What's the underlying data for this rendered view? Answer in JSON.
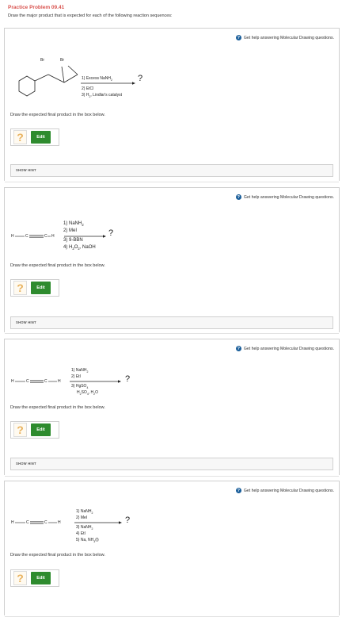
{
  "header": {
    "title": "Practice Problem 09.41",
    "subtitle": "Draw the major product that is expected for each of the following reaction sequences:"
  },
  "help_text": "Get help answering Molecular Drawing questions.",
  "prompt_text": "Draw the expected final product in the box below.",
  "edit_label": "Edit",
  "hint_label": "SHOW HINT",
  "question_mark": "?",
  "placeholder_mark": "?",
  "problems": [
    {
      "atoms": {
        "br1": "Br",
        "br2": "Br"
      },
      "reagents": [
        "1) Excess NaNH",
        "2) EtCl",
        "3) H",
        ", Lindlar's catalyst"
      ],
      "sub_2": "2"
    },
    {
      "atoms": {
        "h_left": "H",
        "c1": "C",
        "c2": "C",
        "h_right": "H"
      },
      "reagents": [
        "1) NaNH",
        "2) MeI",
        "3) 9-BBN",
        "4) H",
        "O",
        ", NaOH"
      ],
      "sub_2": "2"
    },
    {
      "atoms": {
        "h_left": "H",
        "c1": "C",
        "c2": "C",
        "h_right": "H"
      },
      "reagents": [
        "1) NaNH",
        "2) EtI",
        "3) HgSO",
        "H",
        "SO",
        ", H",
        "O"
      ],
      "sub_2": "2",
      "sub_4": "4"
    },
    {
      "atoms": {
        "h_left": "H",
        "c1": "C",
        "c2": "C",
        "h_right": "H"
      },
      "reagents": [
        "1) NaNH",
        "2) MeI",
        "3) NaNH",
        "4) EtI",
        "5) Na, NH",
        "(l)"
      ],
      "sub_2": "2",
      "sub_3": "3"
    }
  ]
}
